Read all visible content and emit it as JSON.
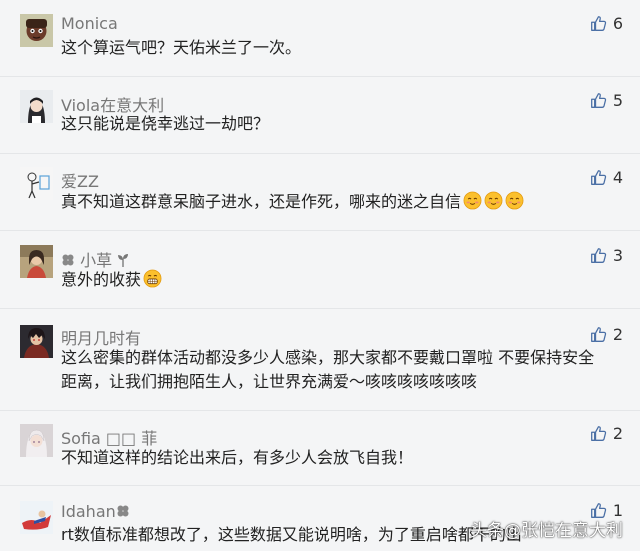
{
  "comments": [
    {
      "user": "Monica",
      "text": "这个算运气吧？天佑米兰了一次。",
      "likes": "6",
      "avatar": "cartoon-girl-avatar"
    },
    {
      "user": "Viola在意大利",
      "text": "这只能说是侥幸逃过一劫吧？",
      "likes": "5",
      "avatar": "anime-girl-avatar"
    },
    {
      "user": "爱ZZ",
      "text": "真不知道这群意呆脑子进水，还是作死，哪来的迷之自信",
      "likes": "4",
      "avatar": "sketch-person-avatar"
    },
    {
      "user": "小草",
      "text": "意外的收获",
      "likes": "3",
      "avatar": "woman-photo-avatar"
    },
    {
      "user": "明月几时有",
      "text_lines": [
        "这么密集的群体活动都没多少人感染，那大家都不要戴口罩啦 不要保持安全",
        "距离，让我们拥抱陌生人，让世界充满爱～咳咳咳咳咳咳咳"
      ],
      "likes": "2",
      "avatar": "anime-character-avatar"
    },
    {
      "user": "Sofia □□ 菲",
      "text": "不知道这样的结论出来后，有多少人会放飞自我！",
      "likes": "2",
      "avatar": "white-hair-avatar"
    },
    {
      "user": "Idahan",
      "text": "rt数值标准都想改了，这些数据又能说明啥，为了重启啥都干的出",
      "likes": "1",
      "avatar": "superhero-avatar"
    }
  ],
  "watermark": "头条@张恺在意大利",
  "colors": {
    "like_icon": "#4a6fa5",
    "background": "#f4f5f6",
    "username": "#777777"
  }
}
